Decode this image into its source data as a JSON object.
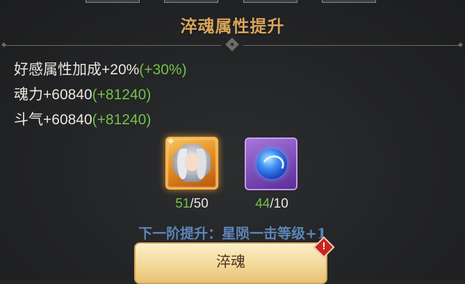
{
  "panel": {
    "title": "淬魂属性提升"
  },
  "attributes": [
    {
      "label": "好感属性加成",
      "value": "+20%",
      "bonus": "(+30%)"
    },
    {
      "label": "魂力",
      "value": "+60840",
      "bonus": "(+81240)"
    },
    {
      "label": "斗气",
      "value": "+60840",
      "bonus": "(+81240)"
    }
  ],
  "materials": [
    {
      "icon": "hero-portrait-icon",
      "have": "51",
      "need": "/50",
      "frame_color": "#f7b54a"
    },
    {
      "icon": "blue-soul-orb-icon",
      "have": "44",
      "need": "/10",
      "frame_color": "#c69df0"
    }
  ],
  "next_tier": "下一阶提升：星陨一击等级+1",
  "action": {
    "label": "淬魂",
    "badge": "!"
  },
  "colors": {
    "title": "#d8a55c",
    "bonus": "#74c04a",
    "next_tier": "#5c86b8",
    "button": "#f3d99a",
    "badge": "#c7261f"
  }
}
